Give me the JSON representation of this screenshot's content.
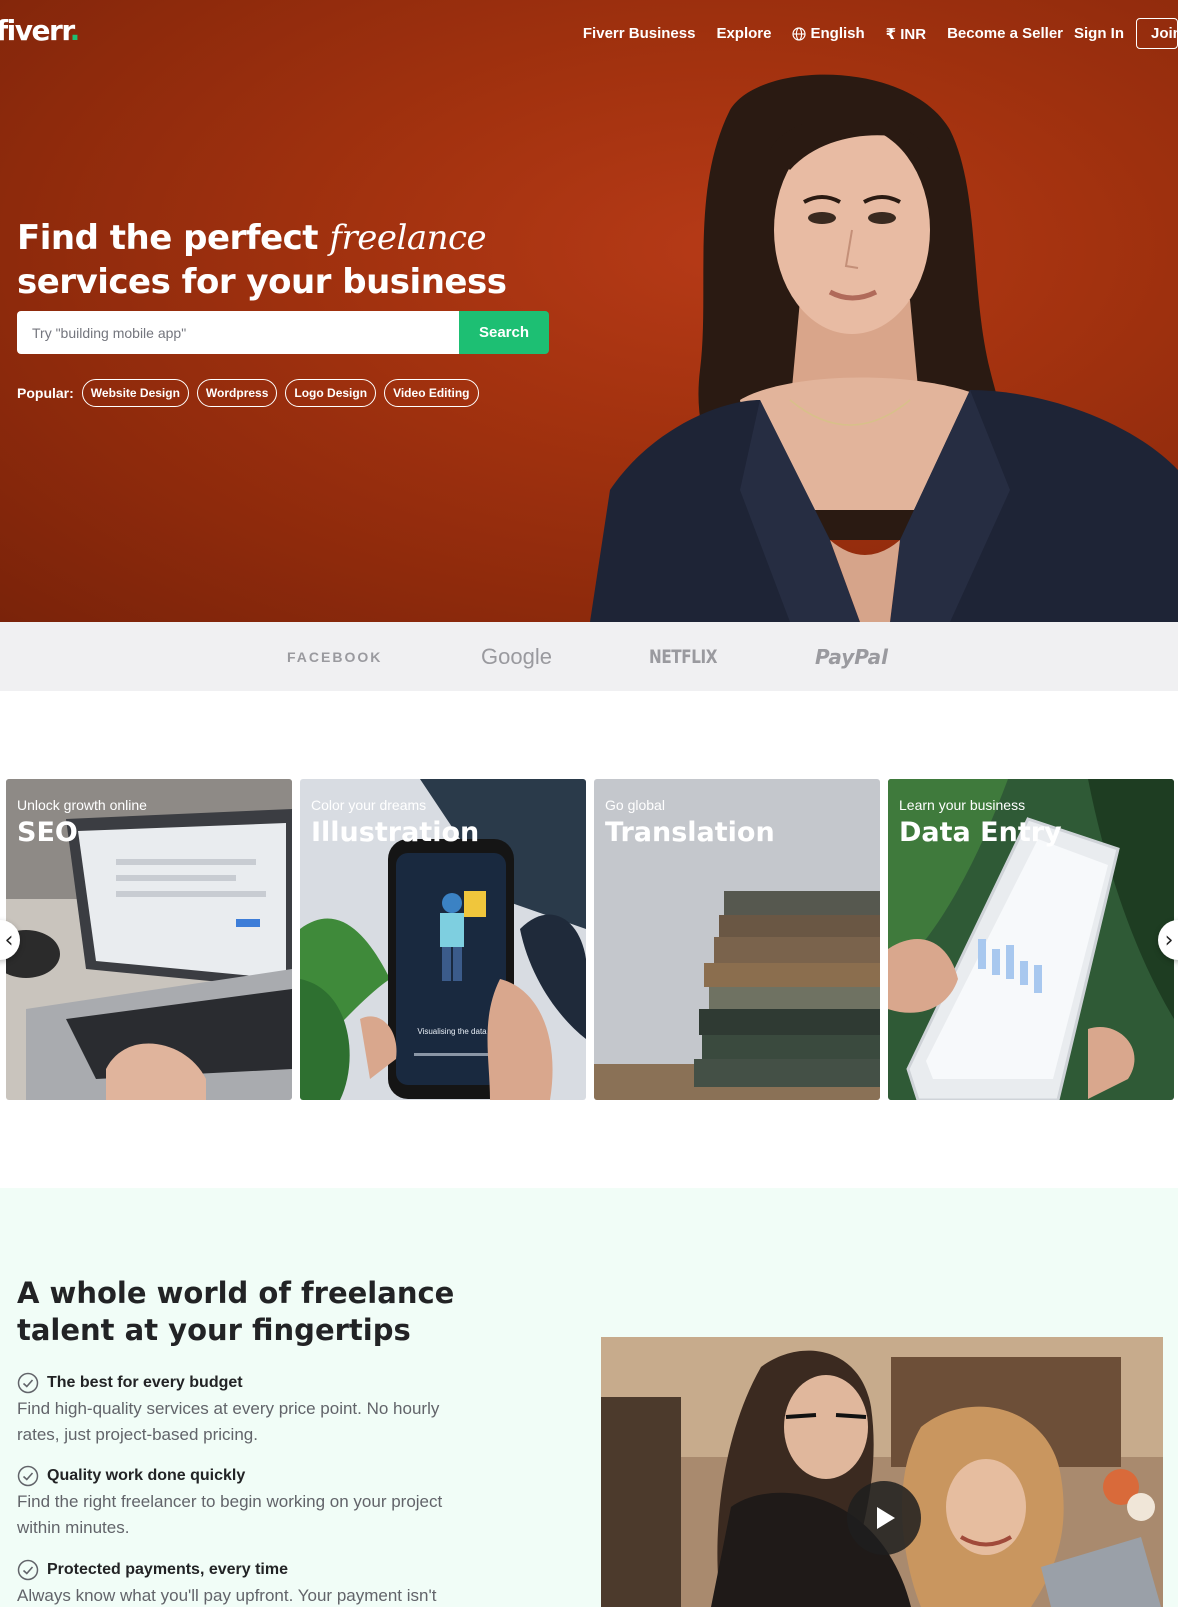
{
  "nav": {
    "logo": "fiverr",
    "logo_dot": ".",
    "links": [
      "Fiverr Business",
      "Explore",
      "English",
      "₹ INR",
      "Become a Seller",
      "Sign In"
    ],
    "join": "Join"
  },
  "hero": {
    "title_part1": "Find the perfect ",
    "title_italic": "freelance",
    "title_part2": " services for your business",
    "search_placeholder": "Try \"building mobile app\"",
    "search_button": "Search",
    "popular_label": "Popular:",
    "popular_tags": [
      "Website Design",
      "Wordpress",
      "Logo Design",
      "Video Editing"
    ]
  },
  "trusted": {
    "brands": [
      "FACEBOOK",
      "Google",
      "NETFLIX",
      "PayPal"
    ]
  },
  "categories": [
    {
      "subtitle": "Unlock growth online",
      "title": "SEO"
    },
    {
      "subtitle": "Color your dreams",
      "title": "Illustration"
    },
    {
      "subtitle": "Go global",
      "title": "Translation"
    },
    {
      "subtitle": "Learn your business",
      "title": "Data Entry"
    }
  ],
  "carousel": {
    "prev": "‹",
    "next": "›"
  },
  "phone_caption": "Visualising the data",
  "value": {
    "title": "A whole world of freelance talent at your fingertips",
    "features": [
      {
        "title": "The best for every budget",
        "text": "Find high-quality services at every price point. No hourly rates, just project-based pricing."
      },
      {
        "title": "Quality work done quickly",
        "text": "Find the right freelancer to begin working on your project within minutes."
      },
      {
        "title": "Protected payments, every time",
        "text": "Always know what you'll pay upfront. Your payment isn't"
      }
    ]
  },
  "colors": {
    "brand_green": "#1dbf73",
    "hero_bg": "#a3320f",
    "value_bg": "#f1fdf7"
  },
  "icons": [
    "globe-icon",
    "check-circle-icon",
    "play-icon",
    "chevron-left-icon",
    "chevron-right-icon"
  ]
}
